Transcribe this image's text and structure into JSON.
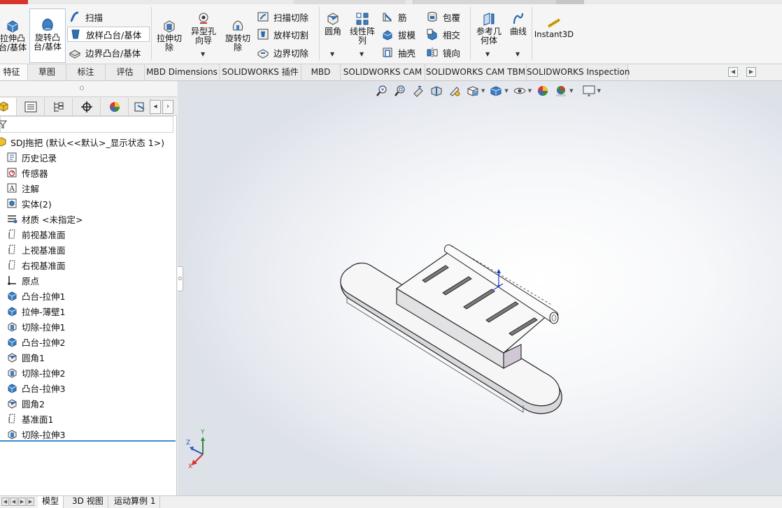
{
  "ribbon": {
    "extrude_boss": "拉伸凸\n台/基体",
    "revolve_boss": "旋转凸\n台/基体",
    "sweep": "扫描",
    "loft_boss": "放样凸台/基体",
    "boundary_boss": "边界凸台/基体",
    "extrude_cut": "拉伸切\n除",
    "hole_wizard": "异型孔\n向导",
    "revolve_cut": "旋转切\n除",
    "swept_cut": "扫描切除",
    "lofted_cut": "放样切割",
    "boundary_cut": "边界切除",
    "fillet": "圆角",
    "linear_pattern": "线性阵\n列",
    "rib": "筋",
    "draft": "拔模",
    "shell": "抽壳",
    "wrap": "包覆",
    "intersect": "相交",
    "mirror": "镜向",
    "ref_geometry": "参考几\n何体",
    "curves": "曲线",
    "instant3d": "Instant3D"
  },
  "tabs": [
    {
      "label": "特征"
    },
    {
      "label": "草图"
    },
    {
      "label": "标注"
    },
    {
      "label": "评估"
    },
    {
      "label": "MBD Dimensions"
    },
    {
      "label": "SOLIDWORKS 插件"
    },
    {
      "label": "MBD"
    },
    {
      "label": "SOLIDWORKS CAM"
    },
    {
      "label": "SOLIDWORKS CAM TBM"
    },
    {
      "label": "SOLIDWORKS Inspection"
    }
  ],
  "tree": {
    "root": "SDJ拖把  (默认<<默认>_显示状态 1>)",
    "items": [
      {
        "label": "历史记录",
        "icon": "history-icon"
      },
      {
        "label": "传感器",
        "icon": "sensor-icon"
      },
      {
        "label": "注解",
        "icon": "annotation-icon"
      },
      {
        "label": "实体(2)",
        "icon": "solid-bodies-icon"
      },
      {
        "label": "材质 <未指定>",
        "icon": "material-icon"
      },
      {
        "label": "前视基准面",
        "icon": "plane-icon"
      },
      {
        "label": "上视基准面",
        "icon": "plane-icon"
      },
      {
        "label": "右视基准面",
        "icon": "plane-icon"
      },
      {
        "label": "原点",
        "icon": "origin-icon"
      },
      {
        "label": "凸台-拉伸1",
        "icon": "boss-extrude-icon"
      },
      {
        "label": "拉伸-薄壁1",
        "icon": "boss-extrude-icon"
      },
      {
        "label": "切除-拉伸1",
        "icon": "cut-extrude-icon"
      },
      {
        "label": "凸台-拉伸2",
        "icon": "boss-extrude-icon"
      },
      {
        "label": "圆角1",
        "icon": "fillet-icon"
      },
      {
        "label": "切除-拉伸2",
        "icon": "cut-extrude-icon"
      },
      {
        "label": "凸台-拉伸3",
        "icon": "boss-extrude-icon"
      },
      {
        "label": "圆角2",
        "icon": "fillet-icon"
      },
      {
        "label": "基准面1",
        "icon": "plane-icon"
      },
      {
        "label": "切除-拉伸3",
        "icon": "cut-extrude-icon"
      }
    ]
  },
  "triad": {
    "x": "X",
    "y": "Y",
    "z": "Z"
  },
  "bottom_tabs": [
    {
      "label": "模型"
    },
    {
      "label": "3D 视图"
    },
    {
      "label": "运动算例 1"
    }
  ],
  "colors": {
    "accent": "#3c8ccf",
    "feature_blue": "#2a6ab0",
    "model_face": "#f2f2f2",
    "model_side": "#d8d8dc"
  }
}
